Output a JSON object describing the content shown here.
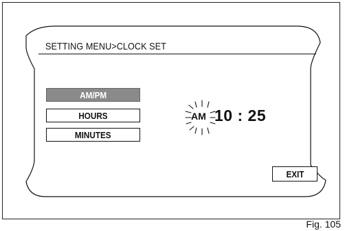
{
  "menu": {
    "title": "SETTING MENU>CLOCK SET",
    "items": [
      {
        "label": "AM/PM",
        "selected": true
      },
      {
        "label": "HOURS",
        "selected": false
      },
      {
        "label": "MINUTES",
        "selected": false
      }
    ]
  },
  "clock": {
    "period": "AM",
    "time": "10 : 25",
    "blinking": "period"
  },
  "exit_label": "EXIT",
  "figure_caption": "Fig. 105",
  "colors": {
    "selected_bg": "#8a8a8a",
    "line": "#111111"
  },
  "icons": {
    "blink": "blink-rays-icon"
  }
}
